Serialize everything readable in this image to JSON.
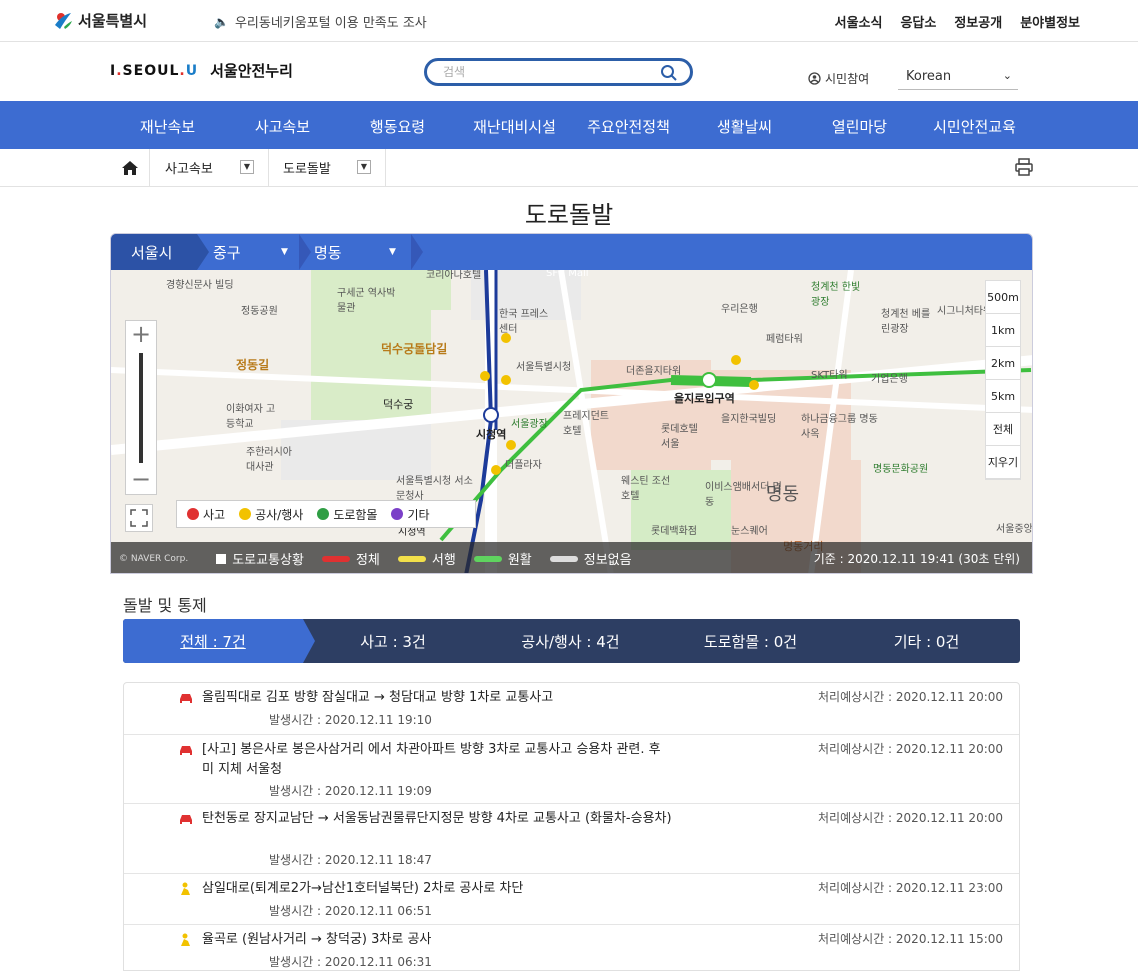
{
  "top": {
    "logo_text": "서울특별시",
    "notice": "우리동네키움포털 이용 만족도 조사",
    "links": [
      "서울소식",
      "응답소",
      "정보공개",
      "분야별정보"
    ]
  },
  "header": {
    "brand_iseoul_1": "I",
    "brand_iseoul_2": ".",
    "brand_iseoul_3": "SEOUL",
    "brand_iseoul_4": ".",
    "brand_iseoul_5": "U",
    "brand_name": "서울안전누리",
    "search_placeholder": "검색",
    "citizen": "시민참여",
    "language": "Korean"
  },
  "gnb": [
    "재난속보",
    "사고속보",
    "행동요령",
    "재난대비시설",
    "주요안전정책",
    "생활날씨",
    "열린마당",
    "시민안전교육"
  ],
  "breadcrumb": [
    "사고속보",
    "도로돌발"
  ],
  "page_title": "도로돌발",
  "map": {
    "header": [
      "서울시",
      "중구",
      "명동"
    ],
    "scales": [
      "500m",
      "1km",
      "2km",
      "5km",
      "전체",
      "지우기"
    ],
    "legend": [
      {
        "label": "사고",
        "color": "#e03131"
      },
      {
        "label": "공사/행사",
        "color": "#f2c200"
      },
      {
        "label": "도로함몰",
        "color": "#2f9e44"
      },
      {
        "label": "기타",
        "color": "#7b3fc8"
      }
    ],
    "naver": "© NAVER Corp.",
    "status": {
      "traffic": "도로교통상황",
      "jam": "정체",
      "slow": "서행",
      "smooth": "원활",
      "none": "정보없음",
      "base": "기준 : 2020.12.11 19:41 (30초 단위)"
    },
    "place_labels": [
      "경향신문사 빌딩",
      "구세군 역사박물관",
      "코리아나호텔",
      "SFC Mall",
      "정동공원",
      "덕수궁돌담길",
      "한국 프레스센터",
      "우리은행",
      "청계천 한빛광장",
      "청계천 베를린광장",
      "시그니처타워",
      "정동길",
      "서울특별시청",
      "더존을지타워",
      "을지로입구역",
      "페럼타워",
      "SKT타워",
      "기업은행",
      "덕수궁",
      "시청역",
      "서울광장",
      "프레지던트 호텔",
      "롯데호텔 서울",
      "을지한국빌딩",
      "하나금융그룹 명동사옥",
      "이화여자 고등학교",
      "주한러시아 대사관",
      "명동문화공원",
      "서울특별시청 서소문청사",
      "더플라자",
      "웨스틴 조선호텔",
      "이비스앰배서더 명동",
      "명동",
      "롯데백화점",
      "눈스퀘어",
      "명동거리",
      "시청역",
      "서울중앙"
    ]
  },
  "section_title": "돌발 및 통제",
  "tabs": [
    "전체 : 7건",
    "사고 : 3건",
    "공사/행사 : 4건",
    "도로함몰 : 0건",
    "기타 : 0건"
  ],
  "incidents": [
    {
      "type": "accident",
      "title": "올림픽대로 김포 방향 잠실대교 → 청담대교 방향 1차로 교통사고",
      "expect": "처리예상시간 : 2020.12.11 20:00",
      "time": "발생시간 : 2020.12.11 19:10"
    },
    {
      "type": "accident",
      "title": "[사고] 봉은사로 봉은사삼거리 에서 차관아파트 방향 3차로 교통사고 승용차 관련. 후미 지체 서울청",
      "expect": "처리예상시간 : 2020.12.11 20:00",
      "time": "발생시간 : 2020.12.11 19:09"
    },
    {
      "type": "accident",
      "title": "탄천동로 장지교남단 → 서울동남권물류단지정문 방향 4차로 교통사고 (화물차-승용차)",
      "expect": "처리예상시간 : 2020.12.11 20:00",
      "time": "발생시간 : 2020.12.11 18:47"
    },
    {
      "type": "construction",
      "title": "삼일대로(퇴계로2가→남산1호터널북단) 2차로 공사로 차단",
      "expect": "처리예상시간 : 2020.12.11 23:00",
      "time": "발생시간 : 2020.12.11 06:51"
    },
    {
      "type": "construction",
      "title": "율곡로 (원남사거리 → 창덕궁) 3차로 공사",
      "expect": "처리예상시간 : 2020.12.11 15:00",
      "time": "발생시간 : 2020.12.11 06:31"
    }
  ],
  "colors": {
    "primary": "#3d6cd1",
    "tab_bg": "#2d3e63",
    "accident": "#e03131",
    "construction": "#f2c200"
  }
}
